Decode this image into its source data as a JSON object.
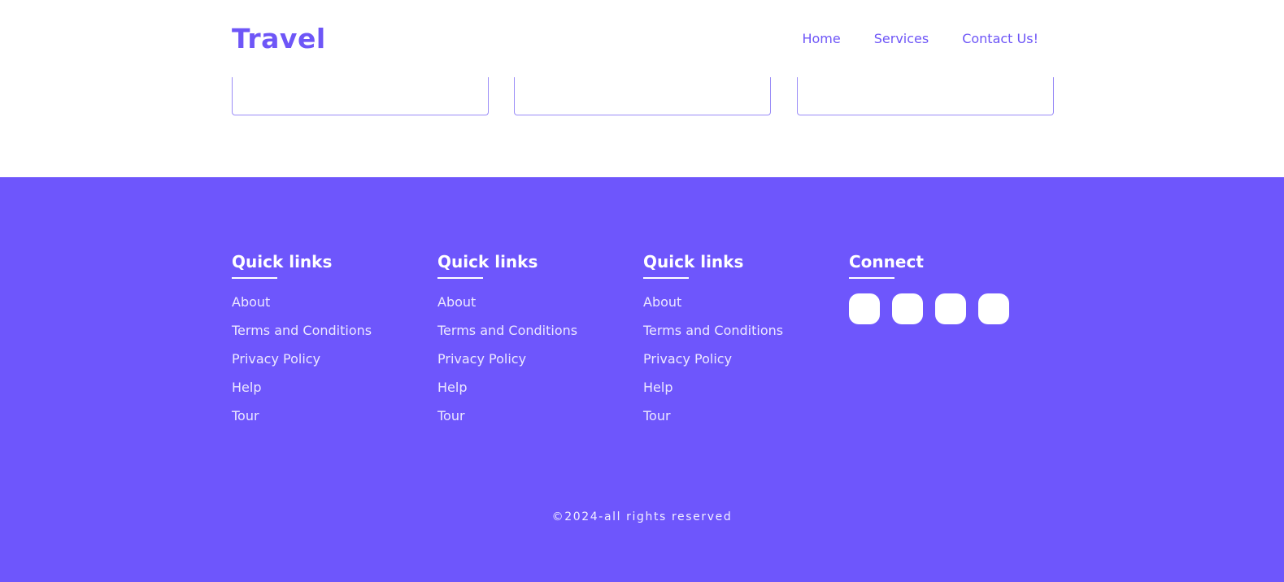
{
  "header": {
    "logo": "Travel",
    "nav": [
      {
        "label": "Home"
      },
      {
        "label": "Services"
      },
      {
        "label": "Contact Us!"
      }
    ]
  },
  "footer": {
    "columns": [
      {
        "title": "Quick links",
        "links": [
          "About",
          "Terms and Conditions",
          "Privacy Policy",
          "Help",
          "Tour"
        ]
      },
      {
        "title": "Quick links",
        "links": [
          "About",
          "Terms and Conditions",
          "Privacy Policy",
          "Help",
          "Tour"
        ]
      },
      {
        "title": "Quick links",
        "links": [
          "About",
          "Terms and Conditions",
          "Privacy Policy",
          "Help",
          "Tour"
        ]
      }
    ],
    "connect": {
      "title": "Connect",
      "icons": [
        "social-icon-1",
        "social-icon-2",
        "social-icon-3",
        "social-icon-4"
      ]
    },
    "copyright": "©2024-all rights reserved"
  },
  "colors": {
    "brand": "#6e56f7",
    "footer_bg": "#6e56fc",
    "card_border": "#9a8cf7"
  }
}
